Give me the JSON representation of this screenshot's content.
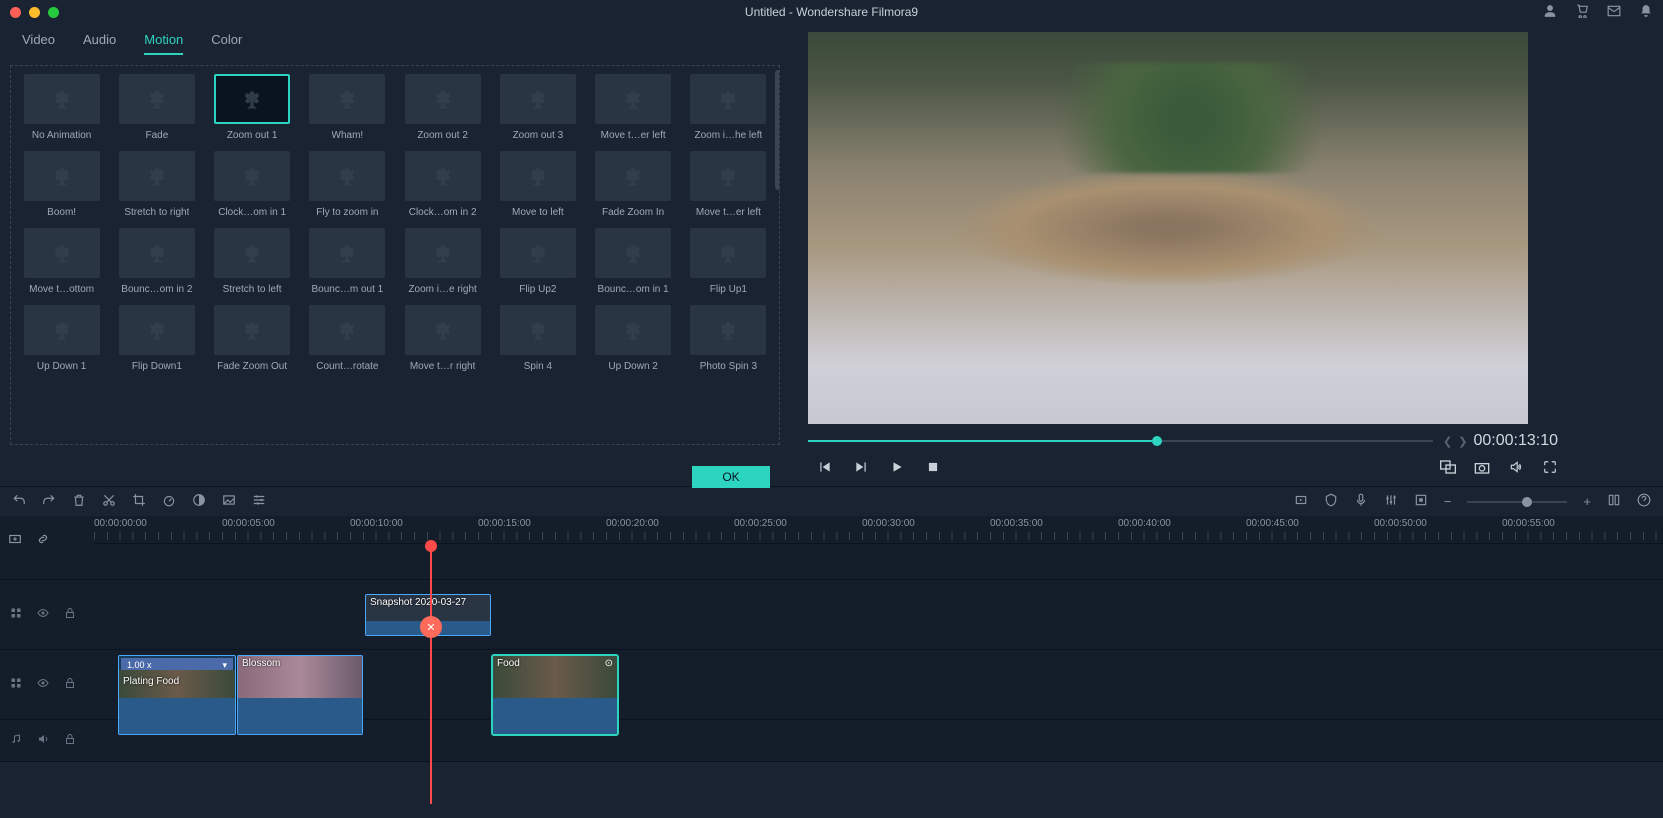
{
  "title": "Untitled - Wondershare Filmora9",
  "tabs": [
    "Video",
    "Audio",
    "Motion",
    "Color"
  ],
  "active_tab": 2,
  "motion_items": [
    {
      "label": "No Animation"
    },
    {
      "label": "Fade"
    },
    {
      "label": "Zoom out 1",
      "selected": true
    },
    {
      "label": "Wham!"
    },
    {
      "label": "Zoom out 2"
    },
    {
      "label": "Zoom out 3"
    },
    {
      "label": "Move t…er left"
    },
    {
      "label": "Zoom i…he left"
    },
    {
      "label": "Boom!"
    },
    {
      "label": "Stretch to right"
    },
    {
      "label": "Clock…om in 1"
    },
    {
      "label": "Fly to zoom in"
    },
    {
      "label": "Clock…om in 2"
    },
    {
      "label": "Move to left"
    },
    {
      "label": "Fade Zoom In"
    },
    {
      "label": "Move t…er left"
    },
    {
      "label": "Move t…ottom"
    },
    {
      "label": "Bounc…om in 2"
    },
    {
      "label": "Stretch to left"
    },
    {
      "label": "Bounc…m out 1"
    },
    {
      "label": "Zoom i…e right"
    },
    {
      "label": "Flip Up2"
    },
    {
      "label": "Bounc…om in 1"
    },
    {
      "label": "Flip Up1"
    },
    {
      "label": "Up Down 1"
    },
    {
      "label": "Flip Down1"
    },
    {
      "label": "Fade Zoom Out"
    },
    {
      "label": "Count…rotate"
    },
    {
      "label": "Move t…r right"
    },
    {
      "label": "Spin 4"
    },
    {
      "label": "Up Down 2"
    },
    {
      "label": "Photo Spin 3"
    }
  ],
  "ok_label": "OK",
  "preview_time": "00:00:13:10",
  "ruler_marks": [
    "00:00:00:00",
    "00:00:05:00",
    "00:00:10:00",
    "00:00:15:00",
    "00:00:20:00",
    "00:00:25:00",
    "00:00:30:00",
    "00:00:35:00",
    "00:00:40:00",
    "00:00:45:00",
    "00:00:50:00",
    "00:00:55:00"
  ],
  "clips": {
    "snapshot": {
      "label": "Snapshot 2020-03-27"
    },
    "plating": {
      "label": "Plating Food",
      "speed": "1.00 x"
    },
    "blossom": {
      "label": "Blossom"
    },
    "food": {
      "label": "Food"
    }
  }
}
